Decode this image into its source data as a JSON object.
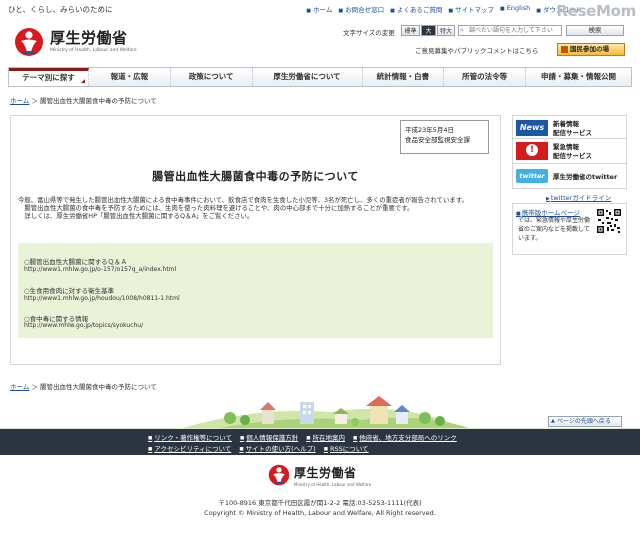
{
  "header": {
    "tagline": "ひと、くらし、みらいのために",
    "top_links": [
      "ホーム",
      "お問合せ窓口",
      "よくあるご質問",
      "サイトマップ",
      "English",
      "ダウンロード"
    ],
    "watermark": "ReseMom",
    "logo_title": "厚生労働省",
    "logo_subtitle": "Ministry of Health, Labour and Welfare",
    "font_size_label": "文字サイズの変更",
    "font_size_options": [
      "標準",
      "大",
      "特大"
    ],
    "search_placeholder": "調べたい語句を入力して下さい",
    "search_button": "検索",
    "opinion_text": "ご意見募集やパブリックコメントはこちら",
    "kokumin_button": "国民参加の場"
  },
  "nav": {
    "tabs": [
      "テーマ別に探す",
      "報道・広報",
      "政策について",
      "厚生労働省について",
      "統計情報・白書",
      "所管の法令等",
      "申請・募集・情報公開"
    ]
  },
  "breadcrumb": {
    "home": "ホーム",
    "separator": "＞",
    "current": "腸管出血性大腸菌食中毒の予防について"
  },
  "article": {
    "date_line1": "平成23年5月4日",
    "date_line2": "食品安全部監視安全課",
    "title": "腸管出血性大腸菌食中毒の予防について",
    "paragraphs": [
      "今般、富山県等で発生した腸管出血性大腸菌による食中毒事件において、飲食店で食肉を生食した小児等、3名が死亡し、多くの重症者が報告されています。",
      "　腸管出血性大腸菌の食中毒を予防するためには、生肉を使った肉料理を避けることや、肉の中心部まで十分に加熱することが重要です。",
      "　詳しくは、厚生労働省HP「腸管出血性大腸菌に関するQ＆A」をご覧ください。"
    ],
    "links": [
      {
        "title": "○腸管出血性大腸菌に関するＱ＆Ａ",
        "url": "http://www1.mhlw.go.jp/o-157/o157q_a/index.html"
      },
      {
        "title": "○生食用食肉に対する衛生基準",
        "url": "http://www1.mhlw.go.jp/houdou/1008/h0811-1.html"
      },
      {
        "title": "○食中毒に関する情報",
        "url": "http://www.mhlw.go.jp/topics/syokuchu/"
      }
    ]
  },
  "sidebar": {
    "news_badge": "News",
    "news_text": [
      "新着情報",
      "配信サービス"
    ],
    "alert_text": [
      "緊急情報",
      "配信サービス"
    ],
    "twitter_badge": "twitter",
    "twitter_text": "厚生労働省のtwitter",
    "twitter_guide": "twitterガイドライン",
    "mobile_title": "携帯版ホームページ",
    "mobile_text": "では、緊急情報や厚生労働省のご案内などを掲載しています。"
  },
  "footer": {
    "page_top": "ページの先頭へ戻る",
    "links_row1": [
      "リンク・著作権等について",
      "個人情報保護方針",
      "所在地案内",
      "他府省、地方支分部局へのリンク"
    ],
    "links_row2": [
      "アクセシビリティについて",
      "サイトの使い方(ヘルプ)",
      "RSSについて"
    ],
    "logo_title": "厚生労働省",
    "logo_subtitle": "Ministry of Health, Labour and Welfare",
    "address": "〒100-8916 東京都千代田区霞が関1-2-2 電話:03-5253-1111(代表)",
    "copyright": "Copyright © Ministry of Health, Labour and Welfare, All Right reserved."
  },
  "colors": {
    "brand_red": "#d71920",
    "link_blue": "#1a4f9c",
    "nav_active": "#8b1a1a",
    "link_box_bg": "#eaf2d8",
    "footer_bar": "#2b3440"
  }
}
